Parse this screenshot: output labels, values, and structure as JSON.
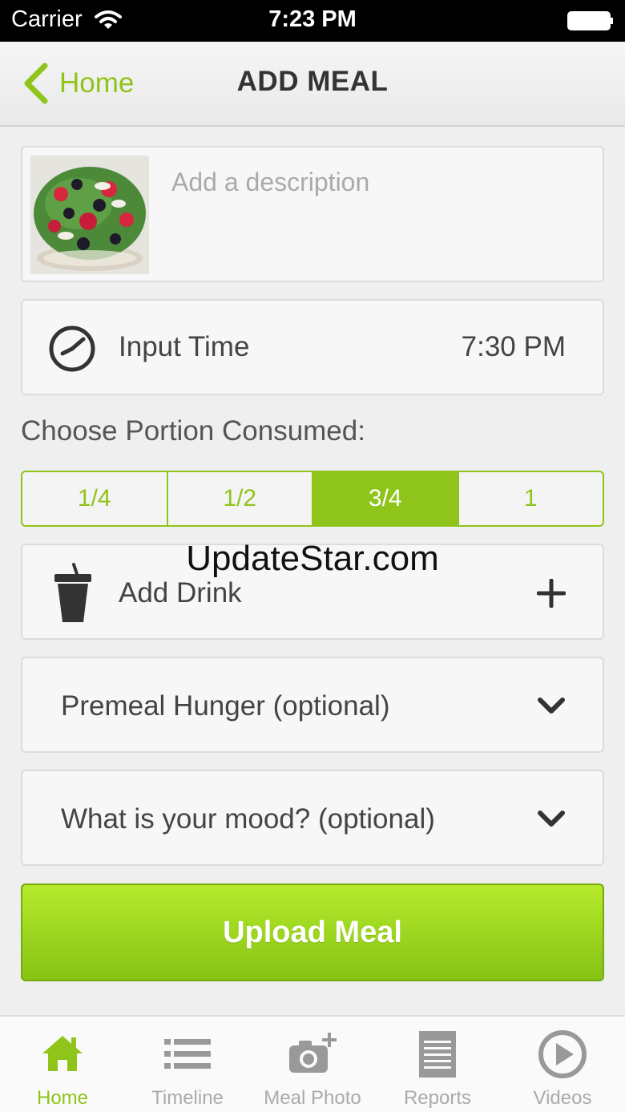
{
  "status_bar": {
    "carrier": "Carrier",
    "time": "7:23 PM"
  },
  "nav": {
    "back_label": "Home",
    "title": "ADD MEAL"
  },
  "description": {
    "placeholder": "Add a description",
    "value": ""
  },
  "time_input": {
    "label": "Input Time",
    "value": "7:30 PM"
  },
  "portion": {
    "label": "Choose Portion Consumed:",
    "options": [
      "1/4",
      "1/2",
      "3/4",
      "1"
    ],
    "selected": "3/4"
  },
  "drink": {
    "label": "Add Drink"
  },
  "hunger": {
    "label": "Premeal Hunger (optional)"
  },
  "mood": {
    "label": "What is your mood? (optional)"
  },
  "upload": {
    "label": "Upload Meal"
  },
  "watermark": "UpdateStar.com",
  "tabs": [
    {
      "label": "Home",
      "icon": "home-icon",
      "active": true
    },
    {
      "label": "Timeline",
      "icon": "list-icon",
      "active": false
    },
    {
      "label": "Meal Photo",
      "icon": "camera-add-icon",
      "active": false
    },
    {
      "label": "Reports",
      "icon": "report-icon",
      "active": false
    },
    {
      "label": "Videos",
      "icon": "play-icon",
      "active": false
    }
  ],
  "colors": {
    "accent": "#8fc41a",
    "upload_top": "#b6ea2c",
    "upload_bottom": "#86c314",
    "inactive": "#aaaaaa"
  }
}
